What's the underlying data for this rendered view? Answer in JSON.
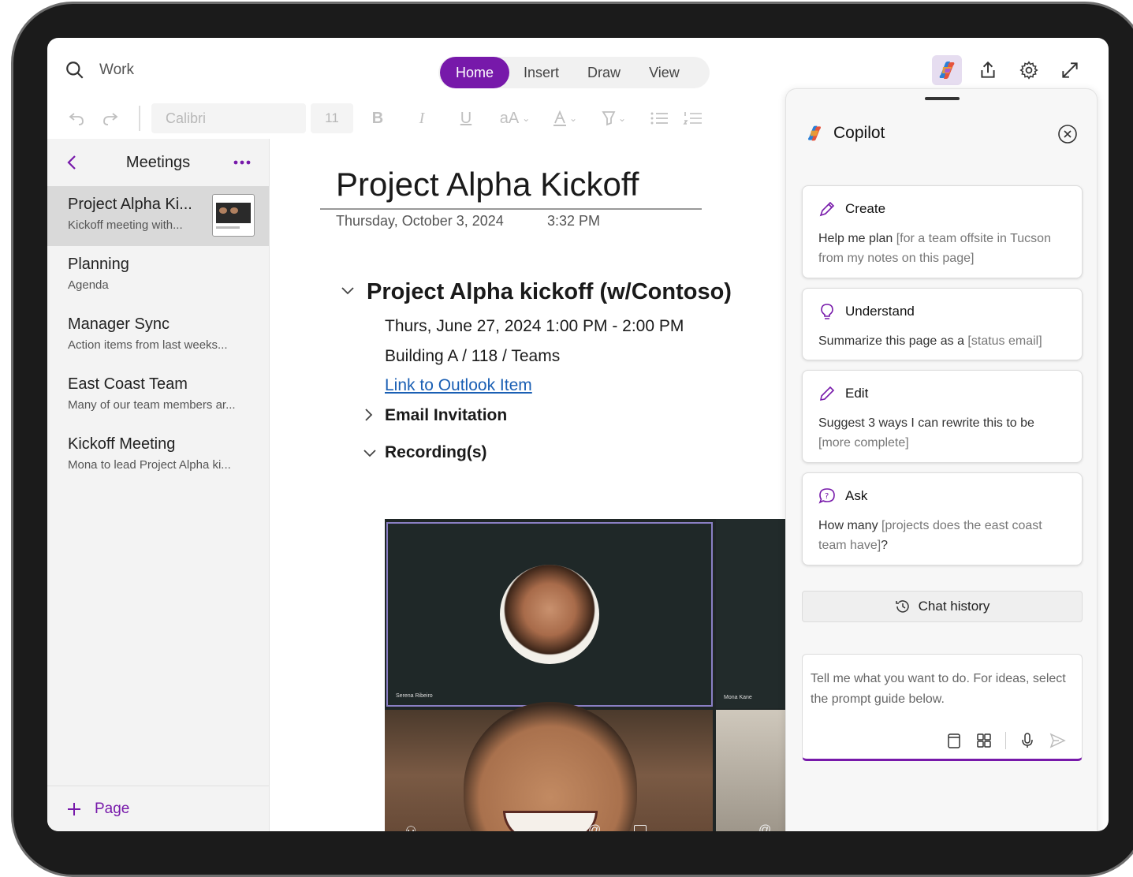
{
  "search": {
    "text": "Work",
    "icon": "search-icon"
  },
  "tabs": [
    {
      "label": "Home",
      "active": true
    },
    {
      "label": "Insert",
      "active": false
    },
    {
      "label": "Draw",
      "active": false
    },
    {
      "label": "View",
      "active": false
    }
  ],
  "ribbon": {
    "font": "Calibri",
    "size": "11",
    "bold": "B",
    "italic": "I",
    "underline": "U",
    "fontsize_label": "aA"
  },
  "section": {
    "title": "Meetings",
    "add_page": "Page",
    "pages": [
      {
        "title": "Project Alpha Ki...",
        "sub": "Kickoff meeting with...",
        "selected": true
      },
      {
        "title": "Planning",
        "sub": "Agenda"
      },
      {
        "title": "Manager Sync",
        "sub": "Action items from last weeks..."
      },
      {
        "title": "East Coast Team",
        "sub": "Many of our team members ar..."
      },
      {
        "title": "Kickoff Meeting",
        "sub": "Mona to lead Project Alpha ki..."
      }
    ]
  },
  "page": {
    "title": "Project Alpha Kickoff",
    "date": "Thursday, October 3, 2024",
    "time": "3:32 PM",
    "heading": "Project Alpha kickoff (w/Contoso)",
    "when": "Thurs, June 27, 2024 1:00 PM - 2:00 PM",
    "where": "Building A / 118 / Teams",
    "link": "Link to Outlook Item",
    "email": "Email Invitation",
    "recordings": "Recording(s)",
    "video_names": [
      "Serena Ribeiro",
      "Mona Kane"
    ]
  },
  "copilot": {
    "title": "Copilot",
    "cards": [
      {
        "label": "Create",
        "text": "Help me plan ",
        "placeholder": "[for a team offsite in Tucson from my notes on this page]",
        "icon": "pen-sparkle-icon"
      },
      {
        "label": "Understand",
        "text": "Summarize this page as a ",
        "placeholder": "[status email]",
        "icon": "lightbulb-icon"
      },
      {
        "label": "Edit",
        "text": "Suggest 3 ways I can rewrite this to be ",
        "placeholder": "[more complete]",
        "icon": "pencil-icon"
      },
      {
        "label": "Ask",
        "text": "How many ",
        "placeholder": "[projects does the east coast team have]",
        "suffix": "?",
        "icon": "question-bubble-icon"
      }
    ],
    "chat_history": "Chat history",
    "input_placeholder": "Tell me what you want to do. For ideas, select the prompt guide below."
  },
  "colors": {
    "accent": "#7719aa",
    "link": "#1a5fb4"
  }
}
